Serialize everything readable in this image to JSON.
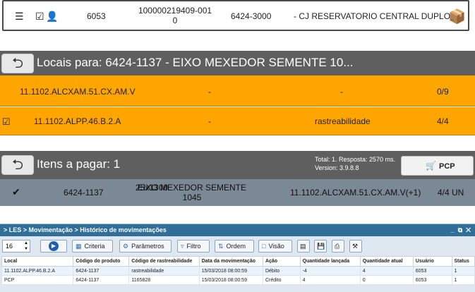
{
  "top_row": {
    "user": "6053",
    "code_line1": "100000219409-001",
    "code_line2": "0",
    "product": "6424-3000",
    "description": "- CJ RESERVATORIO CENTRAL DUPLO"
  },
  "locais": {
    "title": "Locais para: 6424-1137 - EIXO MEXEDOR SEMENTE 10...",
    "rows": [
      {
        "location": "11.1102.ALCXAM.51.CX.AM.V",
        "col2": "-",
        "col3": "-",
        "qty": "0/9",
        "checked": false
      },
      {
        "location": "11.1102.ALPP.46.B.2.A",
        "col2": "-",
        "col3": "rastreabilidade",
        "qty": "4/4",
        "checked": true
      }
    ]
  },
  "itens": {
    "title": "Itens a pagar: 1",
    "info_line1": "Total: 1. Resposta: 2570 ms.",
    "info_line2": "Version: 3.9.8.8",
    "pcp_label": "PCP",
    "row": {
      "code": "6424-1137",
      "desc_line1": "EIXO MEXEDOR SEMENTE 1045",
      "desc_line2": "25x1300",
      "location": "11.1102.ALCXAM.51.CX.AM.V(+1)",
      "qty": "4/4 UN"
    }
  },
  "window": {
    "breadcrumb": "> LES > Movimentação > Histórico de movimentações",
    "page_size": "16",
    "buttons": {
      "criteria": "Criteria",
      "parametros": "Parâmetros",
      "filtro": "Filtro",
      "ordem": "Ordem",
      "visao": "Visão"
    },
    "columns": [
      "Local",
      "Código do produto",
      "Código de rastreabilidade",
      "Data da movimentação",
      "Ação",
      "Quantidade lançada",
      "Quantidade atual",
      "Usuário",
      "Status"
    ],
    "rows": [
      [
        "11.1102.ALPP.46.B.2.A",
        "6424-1137",
        "rastreabilidade",
        "15/03/2018 08:00:59",
        "Débito",
        "-4",
        "4",
        "6053",
        "1"
      ],
      [
        "PCP",
        "6424-1137",
        "1165828",
        "15/03/2018 08:00:59",
        "Crédito",
        "4",
        "0",
        "6053",
        "1"
      ]
    ]
  },
  "colors": {
    "orange": "#ffa500",
    "dark_bar": "#5f5f5f",
    "slate_row": "#7b8896",
    "window_title": "#2f6f9a"
  }
}
